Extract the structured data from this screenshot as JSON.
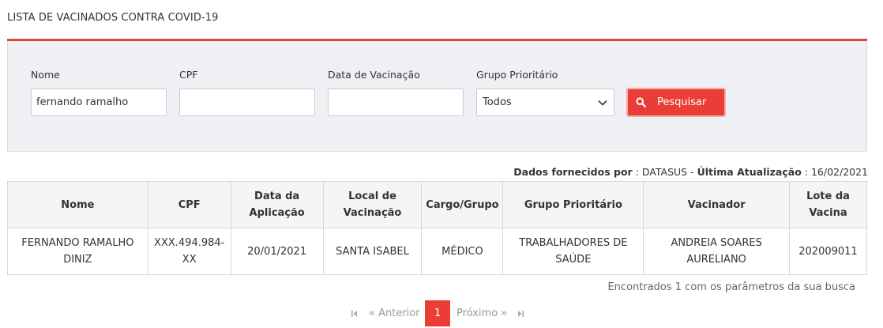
{
  "page": {
    "title": "LISTA DE VACINADOS CONTRA COVID-19"
  },
  "filters": {
    "nome_label": "Nome",
    "nome_value": "fernando ramalho",
    "cpf_label": "CPF",
    "cpf_value": "",
    "data_label": "Data de Vacinação",
    "data_value": "",
    "grupo_label": "Grupo Prioritário",
    "grupo_selected": "Todos",
    "search_label": "Pesquisar"
  },
  "source": {
    "provided_by_label": "Dados fornecidos por",
    "provided_by_value": "DATASUS",
    "updated_label": "Última Atualização",
    "updated_value": "16/02/2021"
  },
  "table": {
    "headers": [
      {
        "line1": "Nome",
        "line2": ""
      },
      {
        "line1": "CPF",
        "line2": ""
      },
      {
        "line1": "Data da",
        "line2": "Aplicação"
      },
      {
        "line1": "Local de",
        "line2": "Vacinação"
      },
      {
        "line1": "Cargo/Grupo",
        "line2": ""
      },
      {
        "line1": "Grupo Prioritário",
        "line2": ""
      },
      {
        "line1": "Vacinador",
        "line2": ""
      },
      {
        "line1": "Lote da",
        "line2": "Vacina"
      }
    ],
    "rows": [
      {
        "nome_l1": "FERNANDO RAMALHO",
        "nome_l2": "DINIZ",
        "cpf_l1": "XXX.494.984-",
        "cpf_l2": "XX",
        "data": "20/01/2021",
        "local": "SANTA ISABEL",
        "cargo": "MÉDICO",
        "grupo_l1": "TRABALHADORES DE",
        "grupo_l2": "SAÚDE",
        "vacinador_l1": "ANDREIA SOARES",
        "vacinador_l2": "AURELIANO",
        "lote": "202009011"
      }
    ]
  },
  "results_count": "Encontrados 1 com os parâmetros da sua busca",
  "pagination": {
    "previous": "« Anterior",
    "current": "1",
    "next": "Próximo »"
  },
  "colors": {
    "accent": "#ea3d36",
    "panel_bg": "#eef0f4"
  }
}
